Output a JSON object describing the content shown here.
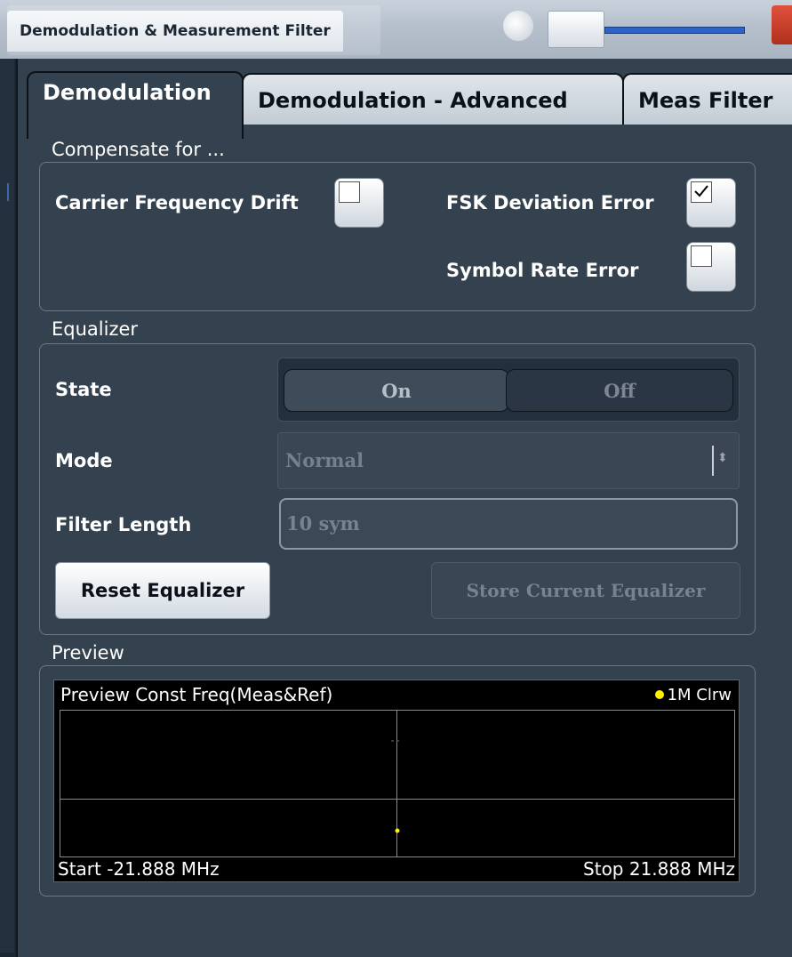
{
  "window": {
    "title": "Demodulation & Measurement Filter"
  },
  "tabs": [
    {
      "label": "Demodulation",
      "active": true
    },
    {
      "label": "Demodulation - Advanced",
      "active": false
    },
    {
      "label": "Meas Filter",
      "active": false
    }
  ],
  "compensate": {
    "section_label": "Compensate for ...",
    "carrier_frequency_drift": {
      "label": "Carrier Frequency Drift",
      "checked": false
    },
    "fsk_deviation_error": {
      "label": "FSK Deviation Error",
      "checked": true
    },
    "symbol_rate_error": {
      "label": "Symbol Rate Error",
      "checked": false
    }
  },
  "equalizer": {
    "section_label": "Equalizer",
    "state_label": "State",
    "state_on": "On",
    "state_off": "Off",
    "mode_label": "Mode",
    "mode_value": "Normal",
    "filter_length_label": "Filter Length",
    "filter_length_value": "10 sym",
    "reset_button": "Reset Equalizer",
    "store_button": "Store Current Equalizer"
  },
  "preview": {
    "section_label": "Preview",
    "diagram_title": "Preview Const Freq(Meas&Ref)",
    "trace_label": "1M Clrw",
    "start": "Start -21.888 MHz",
    "stop": "Stop 21.888 MHz"
  },
  "colors": {
    "dialog_bg": "#34414e",
    "trace_yellow": "#ffee00",
    "close_red": "#c9402c"
  }
}
